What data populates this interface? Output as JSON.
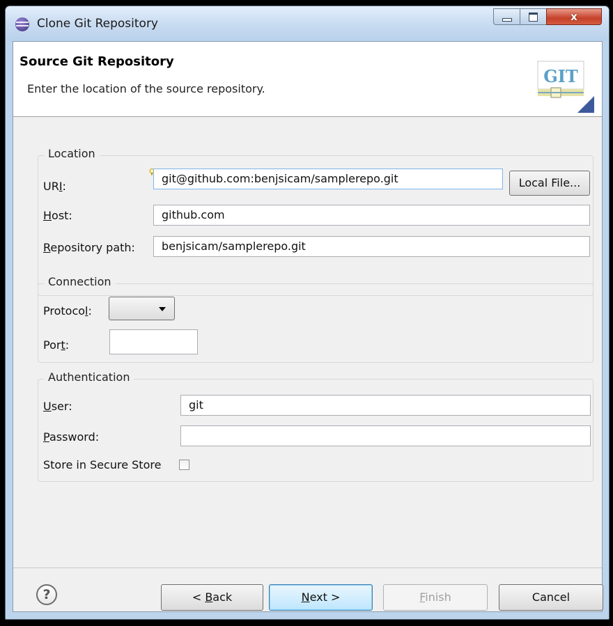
{
  "window": {
    "title": "Clone Git Repository",
    "close_glyph": "x"
  },
  "header": {
    "title": "Source Git Repository",
    "description": "Enter the location of the source repository.",
    "logo_text": "GIT"
  },
  "location": {
    "legend": "Location",
    "uri": {
      "label": "URI:",
      "value": "git@github.com:benjsicam/samplerepo.git"
    },
    "local_file_button": "Local File...",
    "host": {
      "label": "Host:",
      "value": "github.com"
    },
    "repository_path": {
      "label": "Repository path:",
      "value": "benjsicam/samplerepo.git"
    }
  },
  "connection": {
    "legend": "Connection",
    "protocol": {
      "label": "Protocol:",
      "value": ""
    },
    "port": {
      "label": "Port:",
      "value": ""
    }
  },
  "authentication": {
    "legend": "Authentication",
    "user": {
      "label": "User:",
      "value": "git"
    },
    "password": {
      "label": "Password:",
      "value": ""
    },
    "store_secure": {
      "label": "Store in Secure Store",
      "checked": false
    }
  },
  "buttons": {
    "help": "?",
    "back": "< Back",
    "next": "Next >",
    "finish": "Finish",
    "cancel": "Cancel"
  },
  "colors": {
    "titlebar": "#c9dcf1",
    "dialog_bg": "#f0f0f0",
    "close_button": "#c5412a"
  }
}
